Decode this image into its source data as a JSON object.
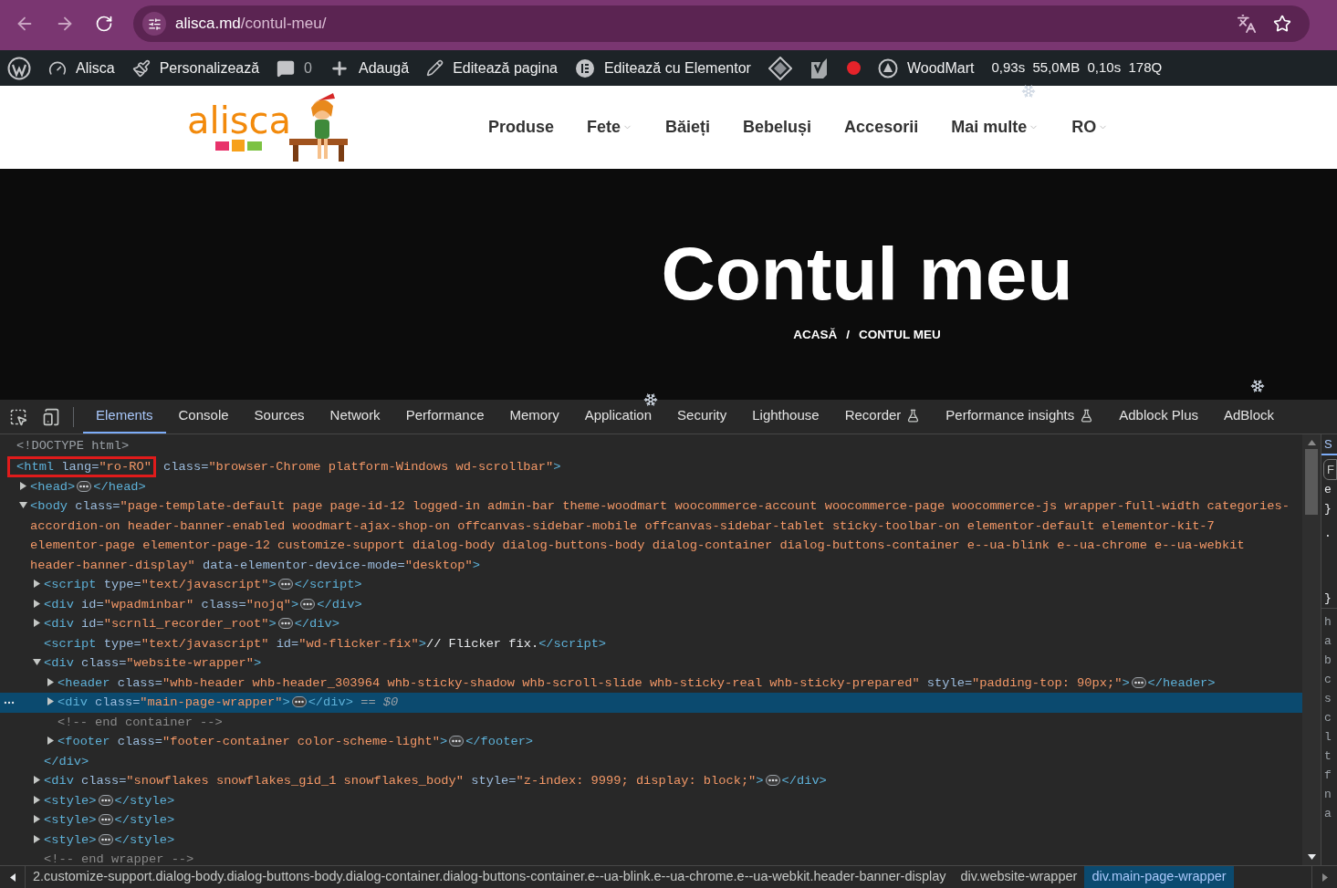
{
  "browser": {
    "domain": "alisca.md",
    "path": "/contul-meu/"
  },
  "admin_bar": {
    "items": [
      {
        "kind": "wordpress"
      },
      {
        "kind": "dashboard",
        "label": "Alisca"
      },
      {
        "kind": "brush",
        "label": "Personalizează"
      },
      {
        "kind": "comments",
        "label": "0"
      },
      {
        "kind": "add",
        "label": "Adaugă"
      },
      {
        "kind": "edit",
        "label": "Editează pagina"
      },
      {
        "kind": "elementor",
        "label": "Editează cu Elementor"
      },
      {
        "kind": "diamond"
      },
      {
        "kind": "yoast"
      },
      {
        "kind": "status_dot"
      },
      {
        "kind": "woodmart",
        "label": "WoodMart"
      },
      {
        "kind": "stats",
        "label": "0,93s  55,0MB  0,10s  178Q"
      }
    ]
  },
  "site": {
    "logo": "alisca",
    "nav": [
      {
        "label": "Produse",
        "dropdown": false
      },
      {
        "label": "Fete",
        "dropdown": true
      },
      {
        "label": "Băieți",
        "dropdown": false
      },
      {
        "label": "Bebeluși",
        "dropdown": false
      },
      {
        "label": "Accesorii",
        "dropdown": false
      },
      {
        "label": "Mai multe",
        "dropdown": true
      },
      {
        "label": "RO",
        "dropdown": true
      }
    ]
  },
  "hero": {
    "title": "Contul meu",
    "breadcrumb": [
      "ACASĂ",
      "/",
      "CONTUL MEU"
    ]
  },
  "devtools": {
    "tabs": [
      {
        "label": "Elements",
        "selected": true,
        "experimental": false
      },
      {
        "label": "Console",
        "selected": false,
        "experimental": false
      },
      {
        "label": "Sources",
        "selected": false,
        "experimental": false
      },
      {
        "label": "Network",
        "selected": false,
        "experimental": false
      },
      {
        "label": "Performance",
        "selected": false,
        "experimental": false
      },
      {
        "label": "Memory",
        "selected": false,
        "experimental": false
      },
      {
        "label": "Application",
        "selected": false,
        "experimental": false
      },
      {
        "label": "Security",
        "selected": false,
        "experimental": false
      },
      {
        "label": "Lighthouse",
        "selected": false,
        "experimental": false
      },
      {
        "label": "Recorder",
        "selected": false,
        "experimental": true
      },
      {
        "label": "Performance insights",
        "selected": false,
        "experimental": true
      },
      {
        "label": "Adblock Plus",
        "selected": false,
        "experimental": false
      },
      {
        "label": "AdBlock",
        "selected": false,
        "experimental": false
      }
    ],
    "tree": [
      {
        "selected": false,
        "tokens": [
          {
            "kind": "doctype",
            "text": "<!DOCTYPE html>"
          }
        ]
      },
      {
        "selected": false,
        "annotated": true,
        "tokens": [
          {
            "kind": "tag",
            "text": "<html"
          },
          {
            "kind": "attr",
            "text": " lang="
          },
          {
            "kind": "value",
            "text": "\"ro-RO\""
          },
          {
            "kind": "attr",
            "text": " class="
          },
          {
            "kind": "value",
            "text": "\"browser-Chrome platform-Windows wd-scrollbar\""
          },
          {
            "kind": "tag",
            "text": ">"
          }
        ],
        "children": [
          {
            "kind": "element",
            "expanded": false,
            "selected": false,
            "tokens": [
              {
                "kind": "tag",
                "text": "<head>"
              },
              {
                "kind": "more"
              },
              {
                "kind": "tag",
                "text": "</head>"
              }
            ]
          },
          {
            "kind": "element",
            "expanded": true,
            "selected": false,
            "tokens": [
              {
                "kind": "tag",
                "text": "<body"
              },
              {
                "kind": "attr",
                "text": " class="
              },
              {
                "kind": "value",
                "text": "\"page-template-default page page-id-12 logged-in admin-bar theme-woodmart woocommerce-account woocommerce-page woocommerce-js wrapper-full-width categories-accordion-on header-banner-enabled woodmart-ajax-shop-on offcanvas-sidebar-mobile offcanvas-sidebar-tablet sticky-toolbar-on elementor-default elementor-kit-7 elementor-page elementor-page-12 customize-support dialog-body dialog-buttons-body dialog-container dialog-buttons-container e--ua-blink e--ua-chrome e--ua-webkit header-banner-display\""
              },
              {
                "kind": "attr",
                "text": " data-elementor-device-mode="
              },
              {
                "kind": "value",
                "text": "\"desktop\""
              },
              {
                "kind": "tag",
                "text": ">"
              }
            ],
            "children": [
              {
                "kind": "element",
                "expanded": false,
                "selected": false,
                "tokens": [
                  {
                    "kind": "tag",
                    "text": "<script"
                  },
                  {
                    "kind": "attr",
                    "text": " type="
                  },
                  {
                    "kind": "value",
                    "text": "\"text/javascript\""
                  },
                  {
                    "kind": "tag",
                    "text": ">"
                  },
                  {
                    "kind": "more"
                  },
                  {
                    "kind": "tag",
                    "text": "</script>"
                  }
                ]
              },
              {
                "kind": "element",
                "expanded": false,
                "selected": false,
                "tokens": [
                  {
                    "kind": "tag",
                    "text": "<div"
                  },
                  {
                    "kind": "attr",
                    "text": " id="
                  },
                  {
                    "kind": "value",
                    "text": "\"wpadminbar\""
                  },
                  {
                    "kind": "attr",
                    "text": " class="
                  },
                  {
                    "kind": "value",
                    "text": "\"nojq\""
                  },
                  {
                    "kind": "tag",
                    "text": ">"
                  },
                  {
                    "kind": "more"
                  },
                  {
                    "kind": "tag",
                    "text": "</div>"
                  }
                ]
              },
              {
                "kind": "element",
                "expanded": false,
                "selected": false,
                "tokens": [
                  {
                    "kind": "tag",
                    "text": "<div"
                  },
                  {
                    "kind": "attr",
                    "text": " id="
                  },
                  {
                    "kind": "value",
                    "text": "\"scrnli_recorder_root\""
                  },
                  {
                    "kind": "tag",
                    "text": ">"
                  },
                  {
                    "kind": "more"
                  },
                  {
                    "kind": "tag",
                    "text": "</div>"
                  }
                ]
              },
              {
                "selected": false,
                "tokens": [
                  {
                    "kind": "tag",
                    "text": "<script"
                  },
                  {
                    "kind": "attr",
                    "text": " type="
                  },
                  {
                    "kind": "value",
                    "text": "\"text/javascript\""
                  },
                  {
                    "kind": "attr",
                    "text": " id="
                  },
                  {
                    "kind": "value",
                    "text": "\"wd-flicker-fix\""
                  },
                  {
                    "kind": "tag",
                    "text": ">"
                  },
                  {
                    "kind": "text",
                    "text": "// Flicker fix."
                  },
                  {
                    "kind": "tag",
                    "text": "</script>"
                  }
                ]
              },
              {
                "kind": "element",
                "expanded": true,
                "selected": false,
                "tokens": [
                  {
                    "kind": "tag",
                    "text": "<div"
                  },
                  {
                    "kind": "attr",
                    "text": " class="
                  },
                  {
                    "kind": "value",
                    "text": "\"website-wrapper\""
                  },
                  {
                    "kind": "tag",
                    "text": ">"
                  }
                ],
                "children": [
                  {
                    "kind": "element",
                    "expanded": false,
                    "selected": false,
                    "tokens": [
                      {
                        "kind": "tag",
                        "text": "<header"
                      },
                      {
                        "kind": "attr",
                        "text": " class="
                      },
                      {
                        "kind": "value",
                        "text": "\"whb-header whb-header_303964 whb-sticky-shadow whb-scroll-slide whb-sticky-real whb-sticky-prepared\""
                      },
                      {
                        "kind": "attr",
                        "text": " style="
                      },
                      {
                        "kind": "value",
                        "text": "\"padding-top: 90px;\""
                      },
                      {
                        "kind": "tag",
                        "text": ">"
                      },
                      {
                        "kind": "more"
                      },
                      {
                        "kind": "tag",
                        "text": "</header>"
                      }
                    ]
                  },
                  {
                    "kind": "element",
                    "expanded": false,
                    "selected": true,
                    "tokens": [
                      {
                        "kind": "tag",
                        "text": "<div"
                      },
                      {
                        "kind": "attr",
                        "text": " class="
                      },
                      {
                        "kind": "value",
                        "text": "\"main-page-wrapper\""
                      },
                      {
                        "kind": "tag",
                        "text": ">"
                      },
                      {
                        "kind": "more"
                      },
                      {
                        "kind": "tag",
                        "text": "</div>"
                      },
                      {
                        "kind": "ref",
                        "text": " == $0"
                      }
                    ]
                  },
                  {
                    "selected": false,
                    "tokens": [
                      {
                        "kind": "comment",
                        "text": "<!-- end container -->"
                      }
                    ]
                  },
                  {
                    "kind": "element",
                    "expanded": false,
                    "selected": false,
                    "tokens": [
                      {
                        "kind": "tag",
                        "text": "<footer"
                      },
                      {
                        "kind": "attr",
                        "text": " class="
                      },
                      {
                        "kind": "value",
                        "text": "\"footer-container color-scheme-light\""
                      },
                      {
                        "kind": "tag",
                        "text": ">"
                      },
                      {
                        "kind": "more"
                      },
                      {
                        "kind": "tag",
                        "text": "</footer>"
                      }
                    ]
                  }
                ]
              },
              {
                "selected": false,
                "tokens": [
                  {
                    "kind": "tag",
                    "text": "</div>"
                  }
                ]
              },
              {
                "kind": "element",
                "expanded": false,
                "selected": false,
                "tokens": [
                  {
                    "kind": "tag",
                    "text": "<div"
                  },
                  {
                    "kind": "attr",
                    "text": " class="
                  },
                  {
                    "kind": "value",
                    "text": "\"snowflakes snowflakes_gid_1 snowflakes_body\""
                  },
                  {
                    "kind": "attr",
                    "text": " style="
                  },
                  {
                    "kind": "value",
                    "text": "\"z-index: 9999; display: block;\""
                  },
                  {
                    "kind": "tag",
                    "text": ">"
                  },
                  {
                    "kind": "more"
                  },
                  {
                    "kind": "tag",
                    "text": "</div>"
                  }
                ]
              },
              {
                "kind": "element",
                "expanded": false,
                "selected": false,
                "tokens": [
                  {
                    "kind": "tag",
                    "text": "<style>"
                  },
                  {
                    "kind": "more"
                  },
                  {
                    "kind": "tag",
                    "text": "</style>"
                  }
                ]
              },
              {
                "kind": "element",
                "expanded": false,
                "selected": false,
                "tokens": [
                  {
                    "kind": "tag",
                    "text": "<style>"
                  },
                  {
                    "kind": "more"
                  },
                  {
                    "kind": "tag",
                    "text": "</style>"
                  }
                ]
              },
              {
                "kind": "element",
                "expanded": false,
                "selected": false,
                "tokens": [
                  {
                    "kind": "tag",
                    "text": "<style>"
                  },
                  {
                    "kind": "more"
                  },
                  {
                    "kind": "tag",
                    "text": "</style>"
                  }
                ]
              },
              {
                "selected": false,
                "tokens": [
                  {
                    "kind": "comment",
                    "text": "<!-- end wrapper -->"
                  }
                ]
              }
            ]
          }
        ]
      }
    ],
    "side_panel": {
      "tab": "S",
      "filter": "F",
      "lines": [
        "e",
        "}",
        ".",
        "}",
        "h",
        "a",
        "b",
        "c",
        "s",
        "c",
        "l",
        "t",
        "f",
        "n",
        "a"
      ]
    },
    "breadcrumbs": [
      {
        "label": "2.customize-support.dialog-body.dialog-buttons-body.dialog-container.dialog-buttons-container.e--ua-blink.e--ua-chrome.e--ua-webkit.header-banner-display",
        "selected": false
      },
      {
        "label": "div.website-wrapper",
        "selected": false
      },
      {
        "label": "div.main-page-wrapper",
        "selected": true
      }
    ]
  }
}
